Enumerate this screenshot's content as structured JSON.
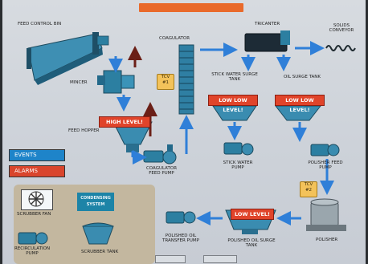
{
  "labels": {
    "feed_control_bin": "FEED CONTROL BIN",
    "mincer": "MINCER",
    "feed_hopper": "FEED HOPPER",
    "coagulator": "COAGULATOR",
    "coagulator_feed_pump": "COAGULATOR FEED PUMP",
    "tricanter": "TRICANTER",
    "solids_conveyor": "SOLIDS CONVEYOR",
    "stick_water_surge_tank": "STICK WATER SURGE TANK",
    "oil_surge_tank": "OIL SURGE TANK",
    "stick_water_pump": "STICK WATER PUMP",
    "polisher_feed_pump": "POLISHER FEED PUMP",
    "polisher": "POLISHER",
    "polished_oil_surge_tank": "POLISHED OIL SURGE TANK",
    "polished_oil_transfer_pump": "POLISHED OIL TRANSFER PUMP",
    "scrubber_fan": "SCRUBBER FAN",
    "condensing_system": "CONDENSING SYSTEM",
    "recirculation_pump": "RECIRCULATION PUMP",
    "scrubber_tank": "SCRUBBER TANK"
  },
  "alarms": {
    "hopper": "HIGH LEVEL!",
    "stick_water": "LOW LOW LEVEL!",
    "oil_surge": "LOW LOW LEVEL!",
    "polished_oil": "LOW LEVEL!"
  },
  "valves": {
    "tcv1": "TCV #1",
    "tcv2": "TCV #2"
  },
  "buttons": {
    "events": "EVENTS",
    "alarms": "ALARMS"
  },
  "colors": {
    "flow_arrow": "#2f7fd8",
    "return_arrow": "#6b1f17",
    "alarm": "#e0442a",
    "valve": "#f3c25a",
    "equipment": "#2c7fa1",
    "events_button": "#1e84c9",
    "alarms_button": "#d9452c"
  }
}
